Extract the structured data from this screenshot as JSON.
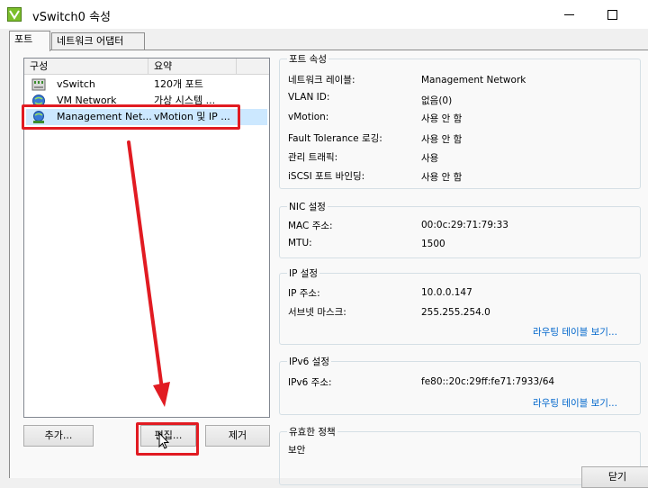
{
  "window": {
    "title": "vSwitch0 속성",
    "minimize_glyph": "—",
    "maximize_glyph": "☐"
  },
  "tabs": [
    {
      "label": "포트",
      "active": true
    },
    {
      "label": "네트워크 어댑터",
      "active": false
    }
  ],
  "config_list": {
    "columns": [
      "구성",
      "요약"
    ],
    "rows": [
      {
        "name": "vSwitch",
        "summary": "120개 포트",
        "icon": "vswitch-icon",
        "selected": false
      },
      {
        "name": "VM Network",
        "summary": "가상 시스템 ...",
        "icon": "globe-icon",
        "selected": false
      },
      {
        "name": "Management Net...",
        "summary": "vMotion 및 IP ...",
        "icon": "vmkernel-globe-icon",
        "selected": true
      }
    ],
    "buttons": {
      "add": "추가...",
      "edit": "편집...",
      "remove": "제거"
    }
  },
  "port_properties": {
    "title": "포트 속성",
    "items": [
      {
        "label": "네트워크 레이블:",
        "value": "Management Network"
      },
      {
        "label": "VLAN ID:",
        "value": "없음(0)"
      },
      {
        "label": "vMotion:",
        "value": "사용 안 함"
      },
      {
        "label": "Fault Tolerance 로깅:",
        "value": "사용 안 함"
      },
      {
        "label": "관리 트래픽:",
        "value": "사용"
      },
      {
        "label": "iSCSI 포트 바인딩:",
        "value": "사용 안 함"
      }
    ]
  },
  "nic_settings": {
    "title": "NIC 설정",
    "items": [
      {
        "label": "MAC 주소:",
        "value": "00:0c:29:71:79:33"
      },
      {
        "label": "MTU:",
        "value": "1500"
      }
    ]
  },
  "ip_settings": {
    "title": "IP 설정",
    "items": [
      {
        "label": "IP 주소:",
        "value": "10.0.0.147"
      },
      {
        "label": "서브넷 마스크:",
        "value": "255.255.254.0"
      }
    ],
    "link": "라우팅 테이블 보기..."
  },
  "ipv6_settings": {
    "title": "IPv6 설정",
    "items": [
      {
        "label": "IPv6 주소:",
        "value": "fe80::20c:29ff:fe71:7933/64"
      }
    ],
    "link": "라우팅 테이블 보기..."
  },
  "effective_policy": {
    "title": "유효한 정책",
    "first_item": "보안"
  },
  "footer": {
    "close": "닫기"
  },
  "annotation_color": "#e11b22",
  "selection_color": "#cce8ff"
}
